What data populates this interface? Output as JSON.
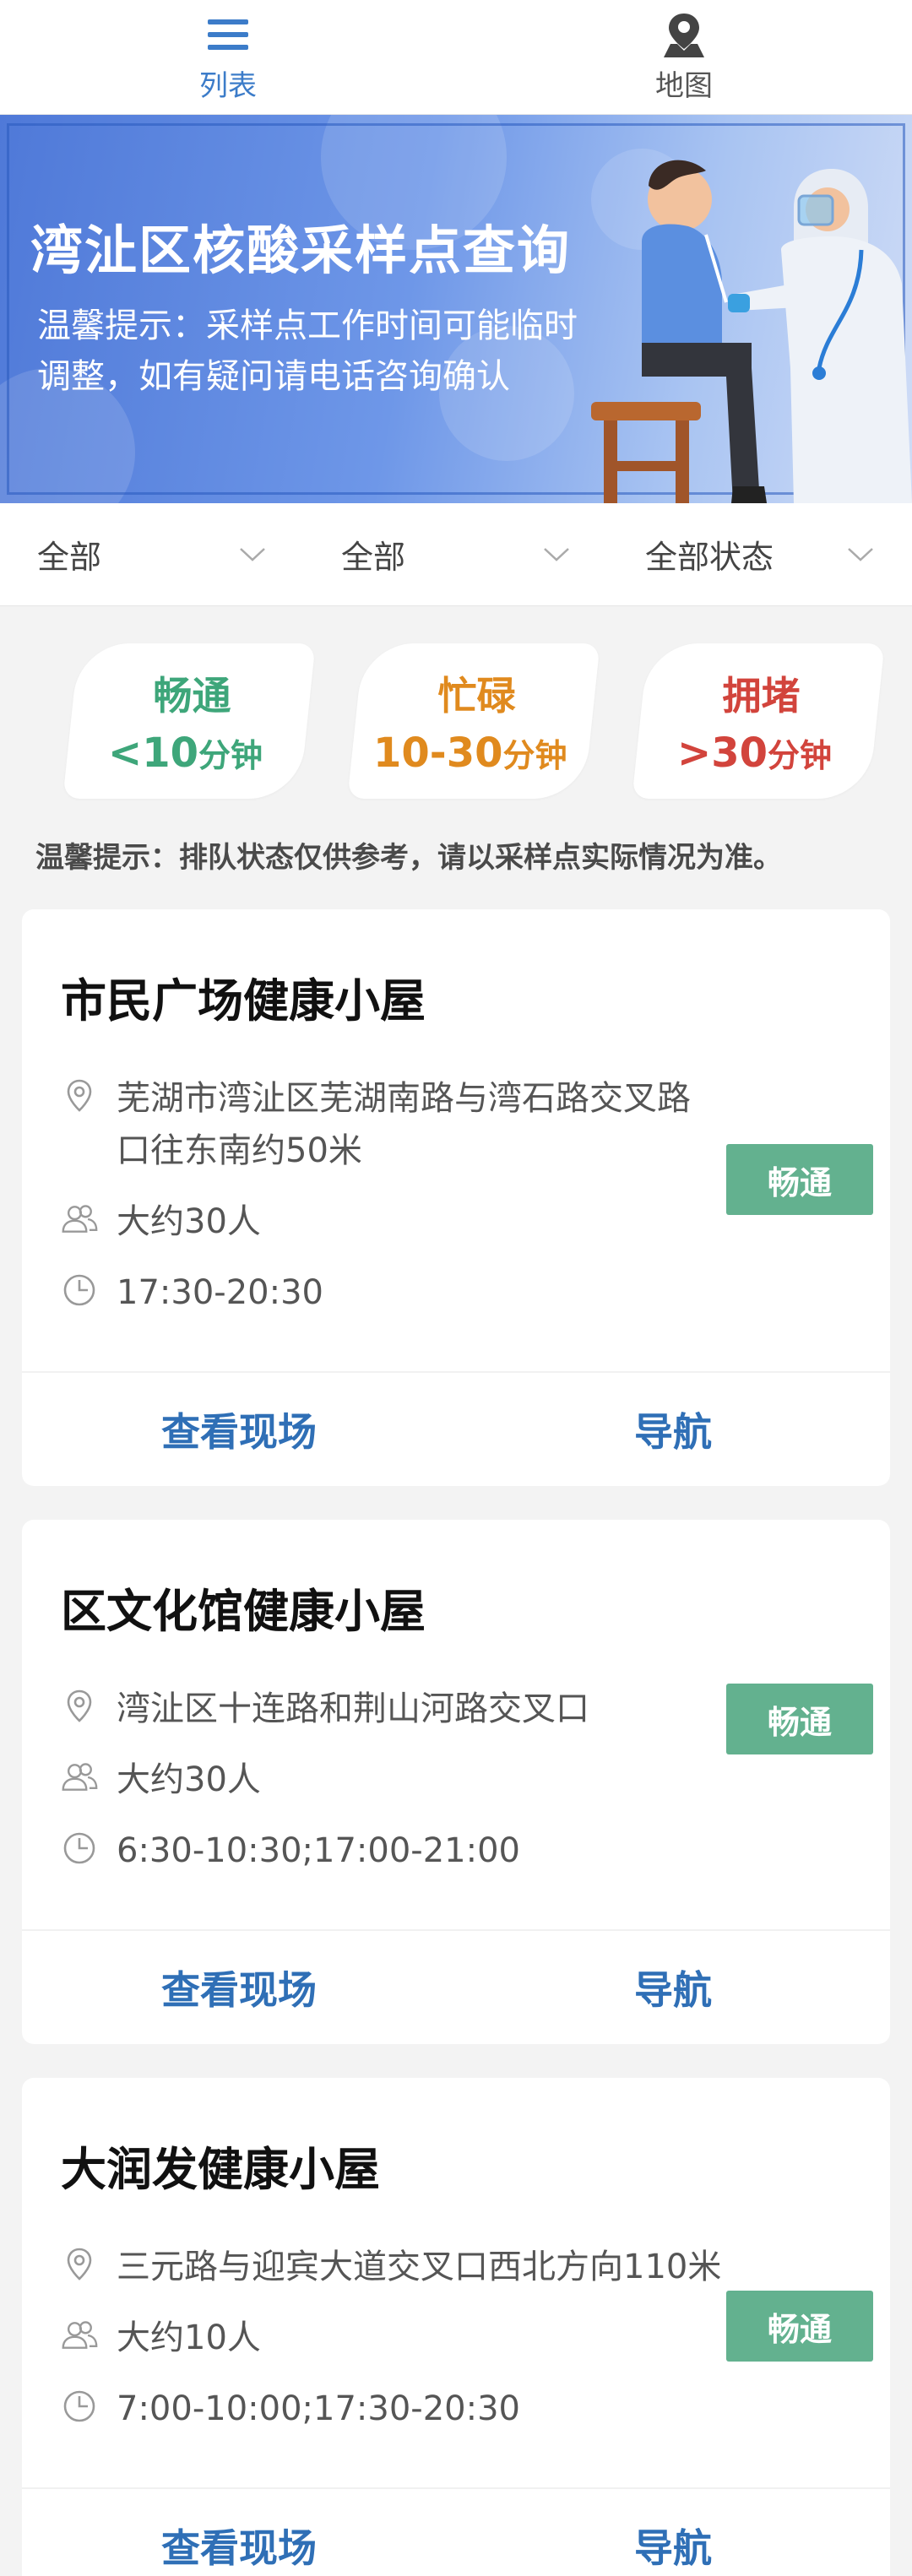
{
  "tabs": [
    {
      "label": "列表",
      "icon": "list-icon",
      "active": true
    },
    {
      "label": "地图",
      "icon": "map-pin-icon",
      "active": false
    }
  ],
  "banner": {
    "title": "湾沚区核酸采样点查询",
    "tip": "温馨提示：采样点工作时间可能临时调整，如有疑问请电话咨询确认"
  },
  "filters": [
    {
      "label": "全部"
    },
    {
      "label": "全部"
    },
    {
      "label": "全部状态"
    }
  ],
  "legend": [
    {
      "name": "畅通",
      "range": "<10",
      "unit": "分钟",
      "color": "#3ea67a"
    },
    {
      "name": "忙碌",
      "range": "10-30",
      "unit": "分钟",
      "color": "#e08a1e"
    },
    {
      "name": "拥堵",
      "range": ">30",
      "unit": "分钟",
      "color": "#d2443c"
    }
  ],
  "notice": "温馨提示：排队状态仅供参考，请以采样点实际情况为准。",
  "cards": [
    {
      "title": "市民广场健康小屋",
      "address": "芜湖市湾沚区芜湖南路与湾石路交叉路口往东南约50米",
      "people": "大约30人",
      "hours": "17:30-20:30",
      "status": "畅通",
      "action_view": "查看现场",
      "action_nav": "导航"
    },
    {
      "title": "区文化馆健康小屋",
      "address": "湾沚区十连路和荆山河路交叉口",
      "people": "大约30人",
      "hours": "6:30-10:30;17:00-21:00",
      "status": "畅通",
      "action_view": "查看现场",
      "action_nav": "导航"
    },
    {
      "title": "大润发健康小屋",
      "address": "三元路与迎宾大道交叉口西北方向110米",
      "people": "大约10人",
      "hours": "7:00-10:00;17:30-20:30",
      "status": "畅通",
      "action_view": "查看现场",
      "action_nav": "导航"
    }
  ],
  "colors": {
    "accent": "#3c7cc9",
    "action": "#2f6fb6",
    "status_green": "#63b18f"
  }
}
